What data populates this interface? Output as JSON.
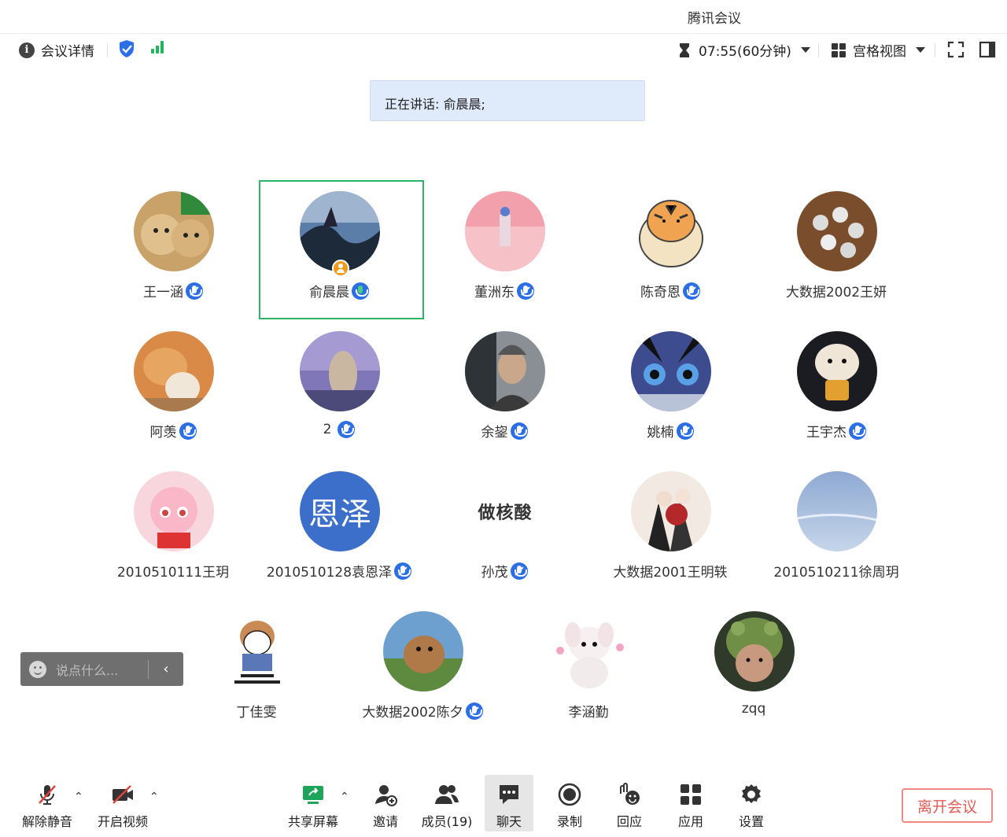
{
  "window": {
    "title": "腾讯会议"
  },
  "toolbar": {
    "meeting_info_label": "会议详情",
    "timer": "07:55(60分钟)",
    "view_label": "宫格视图"
  },
  "speaking": {
    "text": "正在讲话: 俞晨晨;"
  },
  "participants": [
    {
      "name": "王一涵"
    },
    {
      "name": "俞晨晨"
    },
    {
      "name": "董洲东"
    },
    {
      "name": "陈奇恩"
    },
    {
      "name": "大数据2002王妍"
    },
    {
      "name": "阿羡"
    },
    {
      "name": "2"
    },
    {
      "name": "余鋆"
    },
    {
      "name": "姚楠"
    },
    {
      "name": "王宇杰"
    },
    {
      "name": "2010510111王玥"
    },
    {
      "name": "2010510128袁恩泽",
      "avatar_text": "恩泽"
    },
    {
      "name": "孙茂",
      "avatar_text": "做核酸"
    },
    {
      "name": "大数据2001王明轶"
    },
    {
      "name": "2010510211徐周玥"
    },
    {
      "name": "丁佳雯"
    },
    {
      "name": "大数据2002陈夕"
    },
    {
      "name": "李涵勤"
    },
    {
      "name": "zqq"
    }
  ],
  "chat": {
    "placeholder": "说点什么..."
  },
  "bottom": {
    "unmute": "解除静音",
    "start_video": "开启视频",
    "share_screen": "共享屏幕",
    "invite": "邀请",
    "members": "成员(19)",
    "chat": "聊天",
    "record": "录制",
    "react": "回应",
    "apps": "应用",
    "settings": "设置",
    "leave": "离开会议"
  },
  "colors": {
    "accent_blue": "#2b6ee6",
    "speaker_green": "#2fb36a",
    "leave_red": "#e35b55",
    "signal_green": "#22b35e"
  }
}
